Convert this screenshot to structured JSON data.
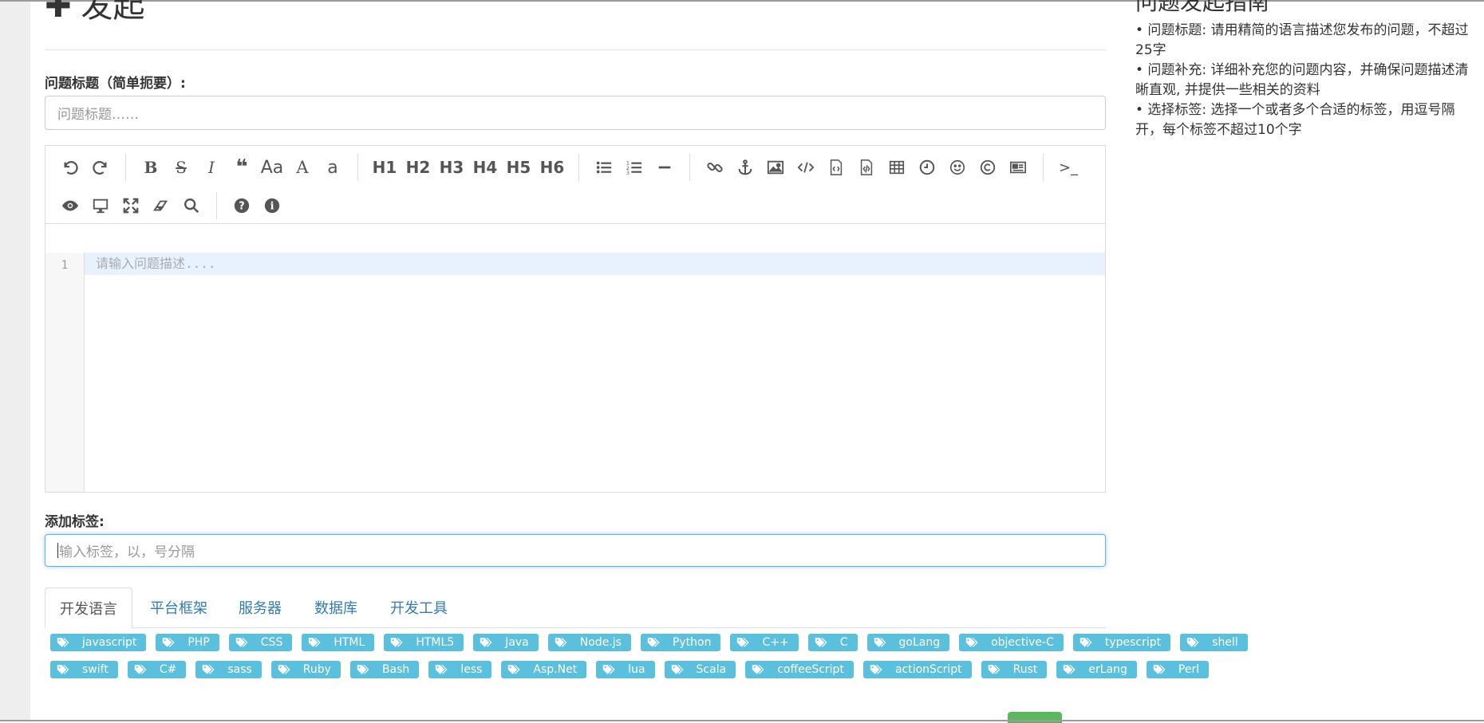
{
  "page": {
    "title": "发起",
    "title_icon": "plus-icon"
  },
  "form": {
    "title_label": "问题标题（简单扼要）:",
    "title_placeholder": "问题标题……",
    "editor_placeholder": "请输入问题描述....",
    "editor_line_number": "1",
    "tags_label": "添加标签:",
    "tags_placeholder": "输入标签，以，号分隔"
  },
  "toolbar": {
    "row1": [
      "undo-icon",
      "redo-icon",
      "|",
      "bold-icon",
      "strikethrough-icon",
      "italic-icon",
      "quote-icon",
      "uppercase-icon",
      "ucwords-icon",
      "lowercase-icon",
      "|",
      "H1",
      "H2",
      "H3",
      "H4",
      "H5",
      "H6",
      "|",
      "list-ul-icon",
      "list-ol-icon",
      "hr-icon",
      "|",
      "link-icon",
      "anchor-icon",
      "image-icon",
      "code-icon",
      "preformatted-code-icon",
      "code-block-icon",
      "table-icon",
      "datetime-icon",
      "emoji-icon",
      "html-entities-icon",
      "pagebreak-icon",
      "|",
      "terminal-icon"
    ],
    "row2": [
      "watch-icon",
      "preview-icon",
      "fullscreen-icon",
      "clear-icon",
      "search-icon",
      "|",
      "help-icon",
      "info-icon"
    ],
    "headings": {
      "h1": "H1",
      "h2": "H2",
      "h3": "H3",
      "h4": "H4",
      "h5": "H5",
      "h6": "H6"
    },
    "aa_label": "Aa",
    "A_label": "A",
    "a_label": "a",
    "terminal_label": ">_"
  },
  "tabs": [
    {
      "label": "开发语言",
      "active": true
    },
    {
      "label": "平台框架",
      "active": false
    },
    {
      "label": "服务器",
      "active": false
    },
    {
      "label": "数据库",
      "active": false
    },
    {
      "label": "开发工具",
      "active": false
    }
  ],
  "tags_row1": [
    "javascript",
    "PHP",
    "CSS",
    "HTML",
    "HTML5",
    "Java",
    "Node.js",
    "Python",
    "C++",
    "C",
    "goLang",
    "objective-C",
    "typescript",
    "shell"
  ],
  "tags_row2": [
    "swift",
    "C#",
    "sass",
    "Ruby",
    "Bash",
    "less",
    "Asp.Net",
    "lua",
    "Scala",
    "coffeeScript",
    "actionScript",
    "Rust",
    "erLang",
    "Perl"
  ],
  "guide": {
    "title": "问题发起指南",
    "items": [
      "• 问题标题: 请用精简的语言描述您发布的问题，不超过25字",
      "• 问题补充: 详细补充您的问题内容，并确保问题描述清晰直观, 并提供一些相关的资料",
      "• 选择标签: 选择一个或者多个合适的标签，用逗号隔开，每个标签不超过10个字"
    ]
  },
  "colors": {
    "tag_bg": "#5bc0de",
    "tab_link": "#337ab7",
    "focus_border": "#66afe9",
    "submit_green": "#5cb85c"
  }
}
